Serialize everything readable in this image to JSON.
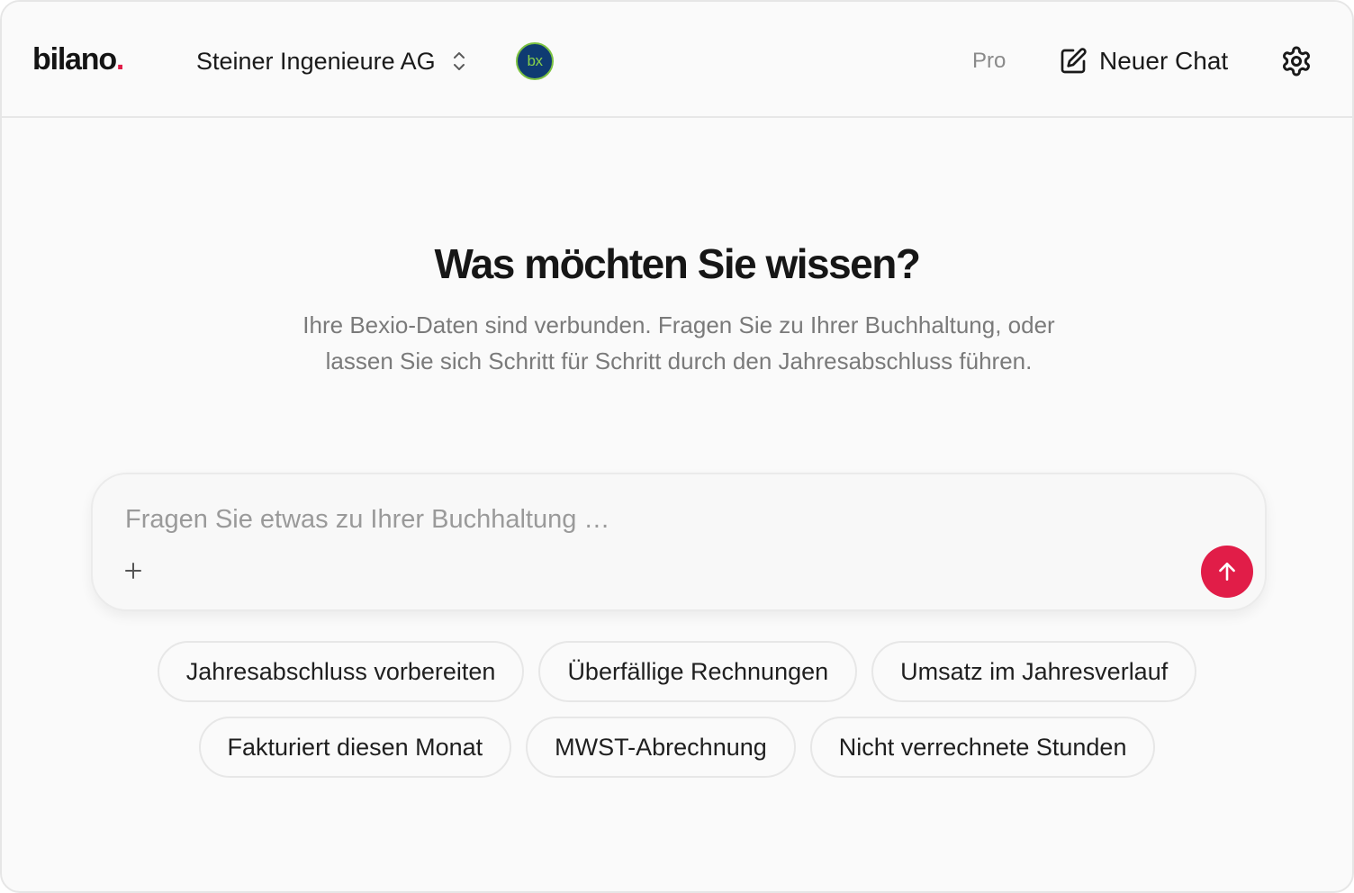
{
  "header": {
    "logo_text": "bilano",
    "logo_dot": ".",
    "company_name": "Steiner Ingenieure AG",
    "integration_badge": "bx",
    "plan_label": "Pro",
    "new_chat_label": "Neuer Chat",
    "icons": {
      "company_switch": "chevron-up-down-icon",
      "new_chat": "edit-icon",
      "settings": "gear-icon"
    }
  },
  "main": {
    "title": "Was möchten Sie wissen?",
    "subtitle": "Ihre Bexio-Daten sind verbunden. Fragen Sie zu Ihrer Buchhaltung, oder lassen Sie sich Schritt für Schritt durch den Jahresabschluss führen.",
    "composer": {
      "placeholder": "Fragen Sie etwas zu Ihrer Buchhaltung …",
      "value": "",
      "attach_icon": "plus-icon",
      "send_icon": "arrow-up-icon"
    },
    "suggestions": [
      "Jahresabschluss vorbereiten",
      "Überfällige Rechnungen",
      "Umsatz im Jahresverlauf",
      "Fakturiert diesen Monat",
      "MWST-Abrechnung",
      "Nicht verrechnete Stunden"
    ]
  },
  "colors": {
    "accent": "#e11d48",
    "background": "#fafafa",
    "badge_bg": "#0f3b72",
    "badge_fg": "#86d04a"
  }
}
